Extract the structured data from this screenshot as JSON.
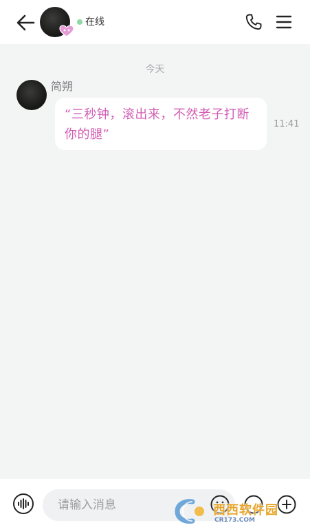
{
  "header": {
    "status_text": "在线",
    "status_color": "#8ed9a6",
    "icons": [
      "back-arrow-icon",
      "heart-badge-icon",
      "phone-icon",
      "menu-icon"
    ]
  },
  "chat": {
    "date_separator": "今天",
    "messages": [
      {
        "sender": "简朔",
        "text": "“三秒钟，滚出来，不然老子打断你的腿”",
        "time": "11:41",
        "text_color": "#d25db4"
      }
    ]
  },
  "composer": {
    "placeholder": "请输入消息",
    "icons": [
      "voice-icon",
      "emoji-icon",
      "gift-icon",
      "plus-icon"
    ]
  },
  "watermark": {
    "title": "西西软件园",
    "subtitle": "CR173.COM"
  }
}
